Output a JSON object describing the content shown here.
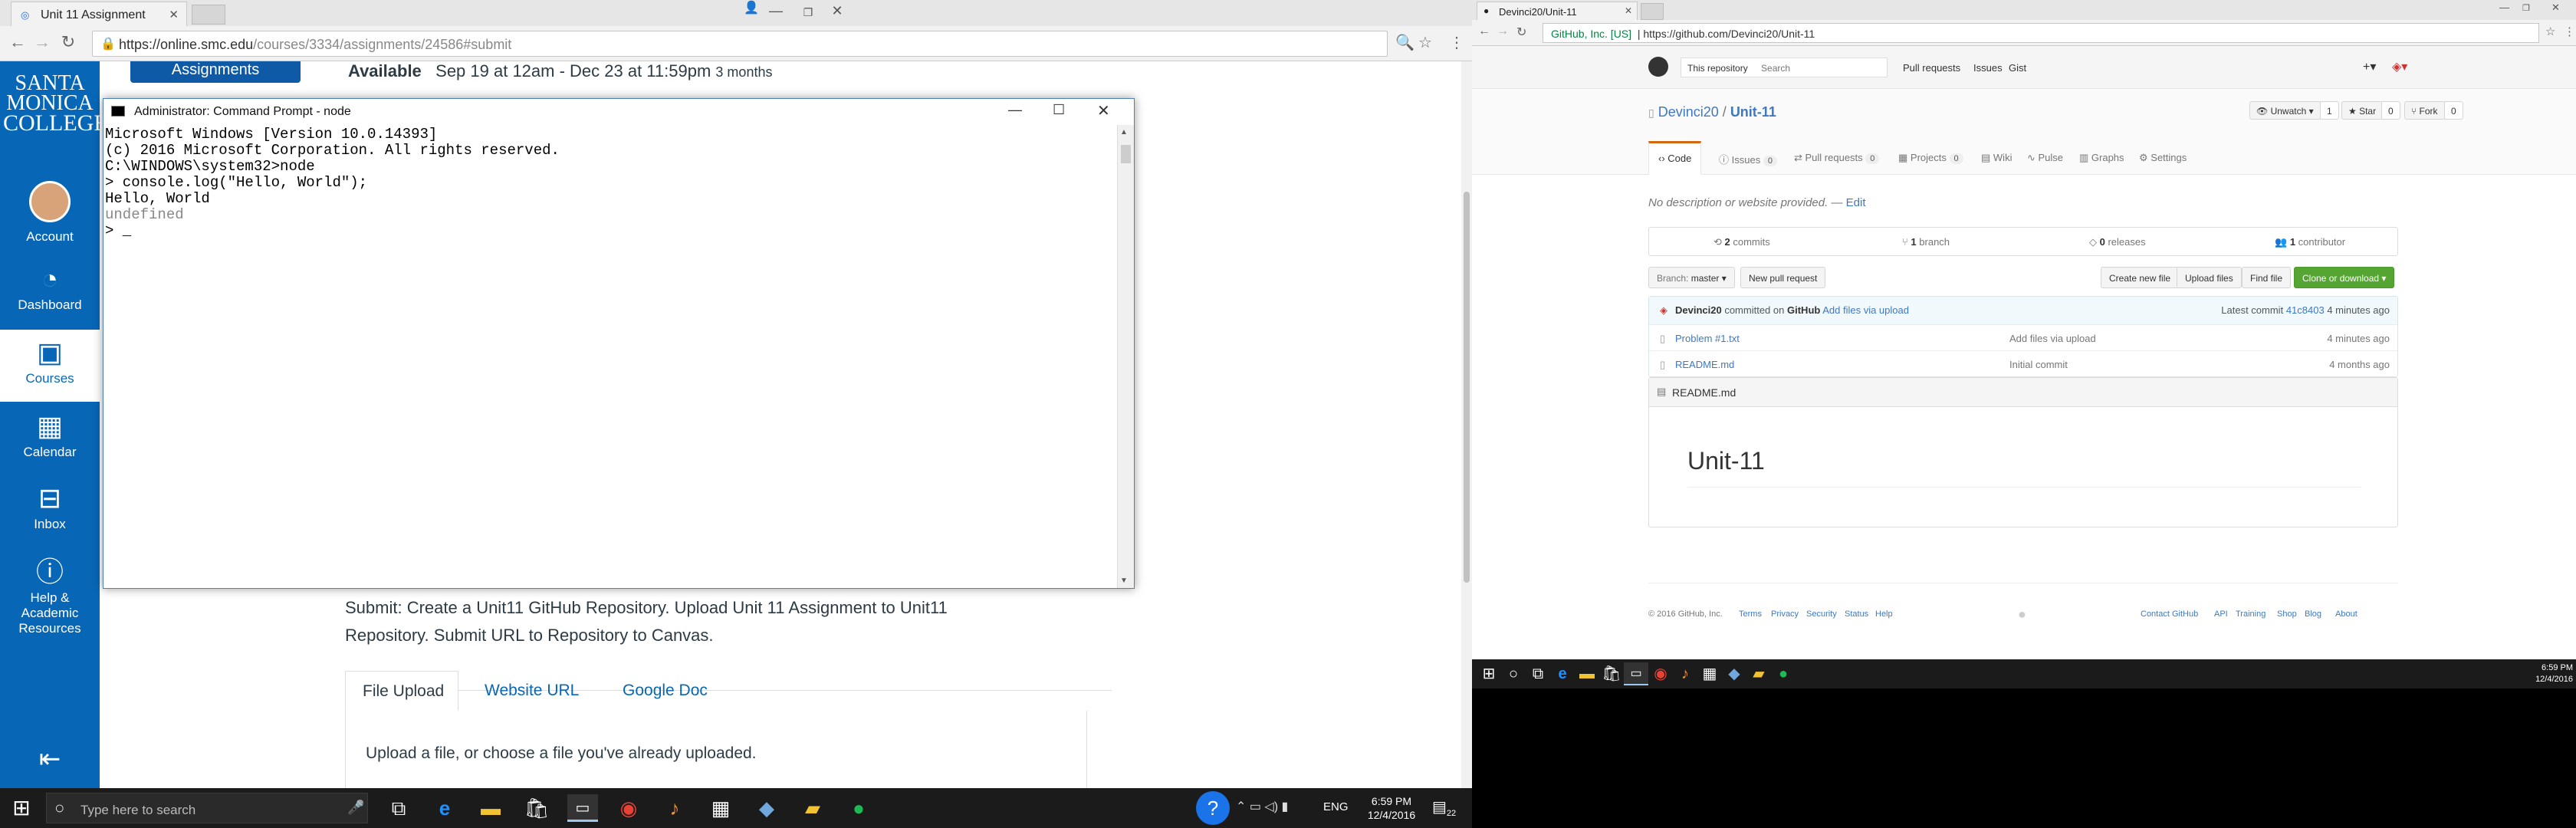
{
  "left_browser": {
    "tab_title": "Unit 11 Assignment",
    "url_host": "https://online.smc.edu",
    "url_path": "/courses/3334/assignments/24586#submit"
  },
  "canvas_nav": {
    "logo_line1": "SANTA",
    "logo_line2": "MONICA",
    "logo_line3": "COLLEGE",
    "items": [
      {
        "label": "Account"
      },
      {
        "label": "Dashboard"
      },
      {
        "label": "Courses"
      },
      {
        "label": "Calendar"
      },
      {
        "label": "Inbox"
      },
      {
        "label": "Help &",
        "label2": "Academic",
        "label3": "Resources"
      }
    ]
  },
  "assignment": {
    "assignments_btn": "Assignments",
    "available_label": "Available",
    "available_dates": "Sep 19 at 12am - Dec 23 at 11:59pm",
    "available_duration": "3 months",
    "submit_text_1": "Submit: Create a Unit11 GitHub Repository. Upload Unit 11 Assignment to Unit11",
    "submit_text_2": "Repository. Submit URL to Repository to Canvas.",
    "tabs": [
      "File Upload",
      "Website URL",
      "Google Doc"
    ],
    "upload_hint": "Upload a file, or choose a file you've already uploaded."
  },
  "cmd": {
    "title": "Administrator: Command Prompt - node",
    "lines": [
      "Microsoft Windows [Version 10.0.14393]",
      "(c) 2016 Microsoft Corporation. All rights reserved.",
      "",
      "C:\\WINDOWS\\system32>node",
      "> console.log(\"Hello, World\");",
      "Hello, World",
      "undefined",
      "> _"
    ]
  },
  "taskbar_left": {
    "search_placeholder": "Type here to search",
    "lang": "ENG",
    "time": "6:59 PM",
    "date": "12/4/2016",
    "notif_count": "22"
  },
  "right_browser": {
    "tab_title": "Devinci20/Unit-11",
    "cert": "GitHub, Inc. [US]",
    "url": "https://github.com/Devinci20/Unit-11"
  },
  "github": {
    "header": {
      "scope": "This repository",
      "search_placeholder": "Search",
      "nav": [
        "Pull requests",
        "Issues",
        "Gist"
      ]
    },
    "repo": {
      "owner": "Devinci20",
      "name": "Unit-11",
      "unwatch": "Unwatch",
      "unwatch_count": "1",
      "star": "Star",
      "star_count": "0",
      "fork": "Fork",
      "fork_count": "0"
    },
    "tabs": [
      {
        "label": "Code"
      },
      {
        "label": "Issues",
        "count": "0"
      },
      {
        "label": "Pull requests",
        "count": "0"
      },
      {
        "label": "Projects",
        "count": "0"
      },
      {
        "label": "Wiki"
      },
      {
        "label": "Pulse"
      },
      {
        "label": "Graphs"
      },
      {
        "label": "Settings"
      }
    ],
    "description": "No description or website provided.",
    "edit": "Edit",
    "summary": {
      "commits_n": "2",
      "commits": "commits",
      "branch_n": "1",
      "branch": "branch",
      "releases_n": "0",
      "releases": "releases",
      "contributor_n": "1",
      "contributor": "contributor"
    },
    "branch_label": "Branch:",
    "branch_name": "master",
    "new_pr": "New pull request",
    "create_file": "Create new file",
    "upload_files": "Upload files",
    "find_file": "Find file",
    "clone": "Clone or download",
    "latest": {
      "author": "Devinci20",
      "committed_on": "committed on",
      "platform": "GitHub",
      "message": "Add files via upload",
      "latest_label": "Latest commit",
      "sha": "41c8403",
      "age": "4 minutes ago"
    },
    "files": [
      {
        "name": "Problem #1.txt",
        "message": "Add files via upload",
        "age": "4 minutes ago"
      },
      {
        "name": "README.md",
        "message": "Initial commit",
        "age": "4 months ago"
      }
    ],
    "readme_label": "README.md",
    "readme_title": "Unit-11",
    "footer_left": [
      "© 2016 GitHub, Inc.",
      "Terms",
      "Privacy",
      "Security",
      "Status",
      "Help"
    ],
    "footer_right": [
      "Contact GitHub",
      "API",
      "Training",
      "Shop",
      "Blog",
      "About"
    ]
  },
  "taskbar_right": {
    "time": "6:59 PM",
    "date": "12/4/2016"
  }
}
